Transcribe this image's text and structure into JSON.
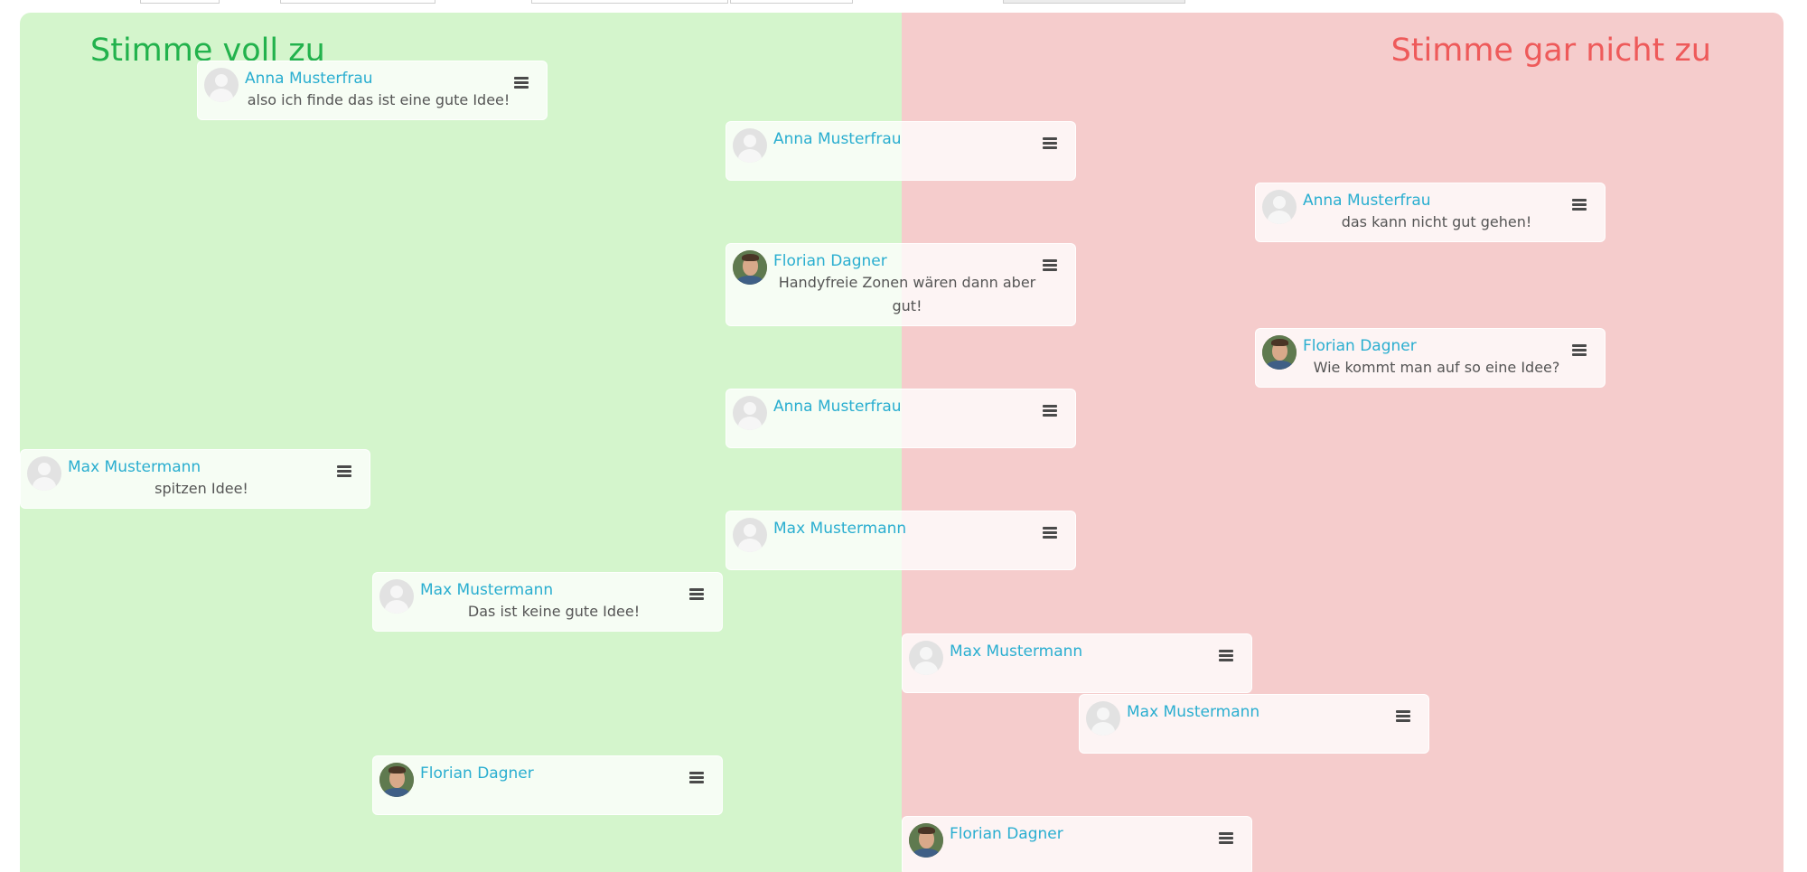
{
  "board": {
    "agree_label": "Stimme voll zu",
    "disagree_label": "Stimme gar nicht zu",
    "colors": {
      "agree_bg": "#d4f5cc",
      "disagree_bg": "#f5cccc",
      "agree_text": "#22b24c",
      "disagree_text": "#ee5a5a",
      "author_link": "#2aaed0"
    }
  },
  "cards": [
    {
      "author": "Anna Musterfrau",
      "text": "also ich finde das ist eine gute Idee!",
      "avatar": "placeholder-avatar",
      "menu_icon": "hamburger-menu-icon"
    },
    {
      "author": "Anna Musterfrau",
      "text": "",
      "avatar": "placeholder-avatar",
      "menu_icon": "hamburger-menu-icon"
    },
    {
      "author": "Anna Musterfrau",
      "text": "das kann nicht gut gehen!",
      "avatar": "placeholder-avatar",
      "menu_icon": "hamburger-menu-icon"
    },
    {
      "author": "Florian Dagner",
      "text": "Handyfreie Zonen wären dann aber gut!",
      "avatar": "photo-avatar",
      "menu_icon": "hamburger-menu-icon"
    },
    {
      "author": "Florian Dagner",
      "text": "Wie kommt man auf so eine Idee?",
      "avatar": "photo-avatar",
      "menu_icon": "hamburger-menu-icon"
    },
    {
      "author": "Anna Musterfrau",
      "text": "",
      "avatar": "placeholder-avatar",
      "menu_icon": "hamburger-menu-icon"
    },
    {
      "author": "Max Mustermann",
      "text": "spitzen Idee!",
      "avatar": "placeholder-avatar",
      "menu_icon": "hamburger-menu-icon"
    },
    {
      "author": "Max Mustermann",
      "text": "",
      "avatar": "placeholder-avatar",
      "menu_icon": "hamburger-menu-icon"
    },
    {
      "author": "Max Mustermann",
      "text": "Das ist keine gute Idee!",
      "avatar": "placeholder-avatar",
      "menu_icon": "hamburger-menu-icon"
    },
    {
      "author": "Max Mustermann",
      "text": "",
      "avatar": "placeholder-avatar",
      "menu_icon": "hamburger-menu-icon"
    },
    {
      "author": "Max Mustermann",
      "text": "",
      "avatar": "placeholder-avatar",
      "menu_icon": "hamburger-menu-icon"
    },
    {
      "author": "Florian Dagner",
      "text": "",
      "avatar": "photo-avatar",
      "menu_icon": "hamburger-menu-icon"
    },
    {
      "author": "Florian Dagner",
      "text": "",
      "avatar": "photo-avatar",
      "menu_icon": "hamburger-menu-icon"
    }
  ]
}
